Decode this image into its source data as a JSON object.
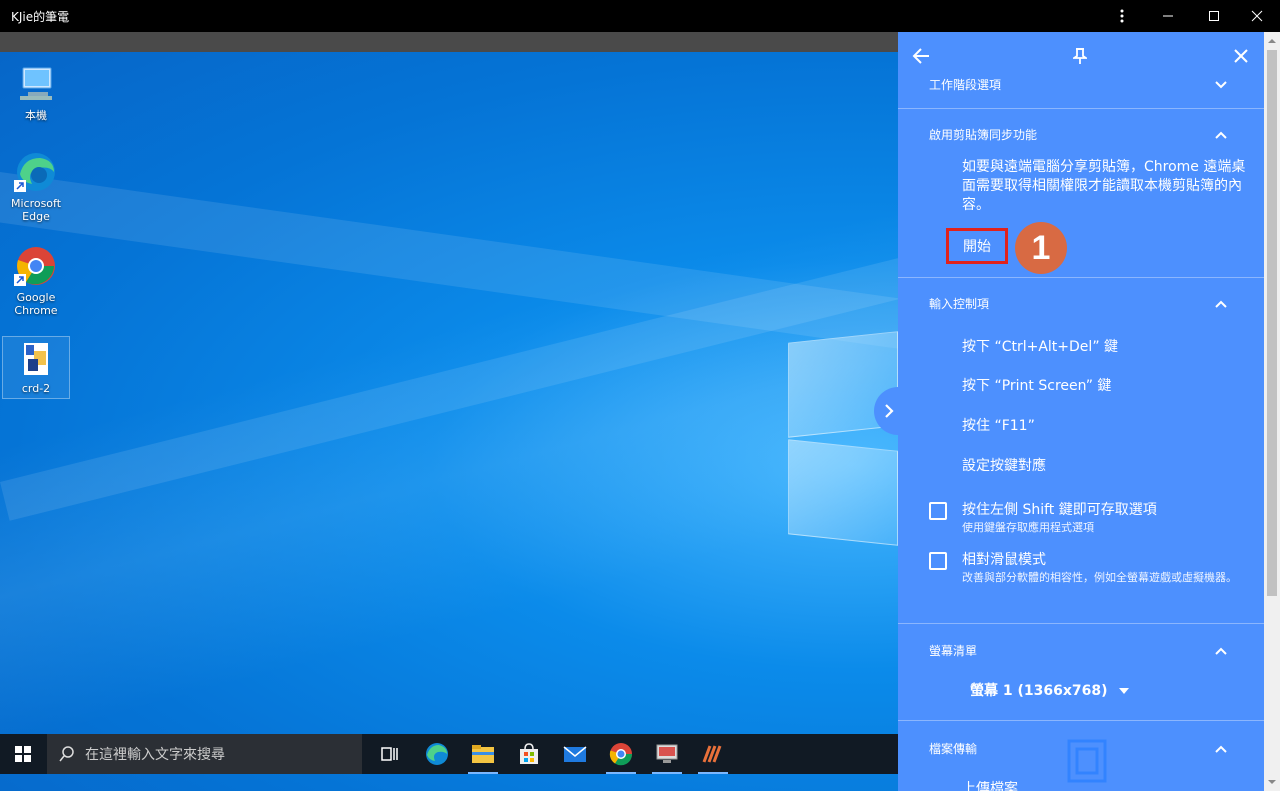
{
  "window": {
    "title": "KJie的筆電"
  },
  "desktop": {
    "icons": [
      {
        "label": "本機",
        "icon": "computer-icon"
      },
      {
        "label": "Microsoft Edge",
        "icon": "edge-icon"
      },
      {
        "label": "Google Chrome",
        "icon": "chrome-icon"
      },
      {
        "label": "crd-2",
        "icon": "shortcut-file-icon"
      }
    ]
  },
  "taskbar": {
    "search_placeholder": "在這裡輸入文字來搜尋"
  },
  "panel": {
    "sections": {
      "session": {
        "title": "工作階段選項"
      },
      "clipboard": {
        "title": "啟用剪貼簿同步功能",
        "description": "如要與遠端電腦分享剪貼簿，Chrome 遠端桌面需要取得相關權限才能讀取本機剪貼簿的內容。",
        "start_label": "開始",
        "step_badge": "1"
      },
      "input": {
        "title": "輸入控制項",
        "items": [
          "按下 “Ctrl+Alt+Del” 鍵",
          "按下 “Print Screen” 鍵",
          "按住 “F11”",
          "設定按鍵對應"
        ],
        "shift_option": {
          "label": "按住左側 Shift 鍵即可存取選項",
          "sub": "使用鍵盤存取應用程式選項"
        },
        "relative_mouse": {
          "label": "相對滑鼠模式",
          "sub": "改善與部分軟體的相容性，例如全螢幕遊戲或虛擬機器。"
        }
      },
      "displays": {
        "title": "螢幕清單",
        "selected": "螢幕 1 (1366x768)"
      },
      "files": {
        "title": "檔案傳輸",
        "upload_label": "上傳檔案"
      }
    }
  },
  "colors": {
    "panel_bg": "#4d90fe",
    "highlight_border": "#e1221c",
    "badge_bg": "#d86a43"
  }
}
